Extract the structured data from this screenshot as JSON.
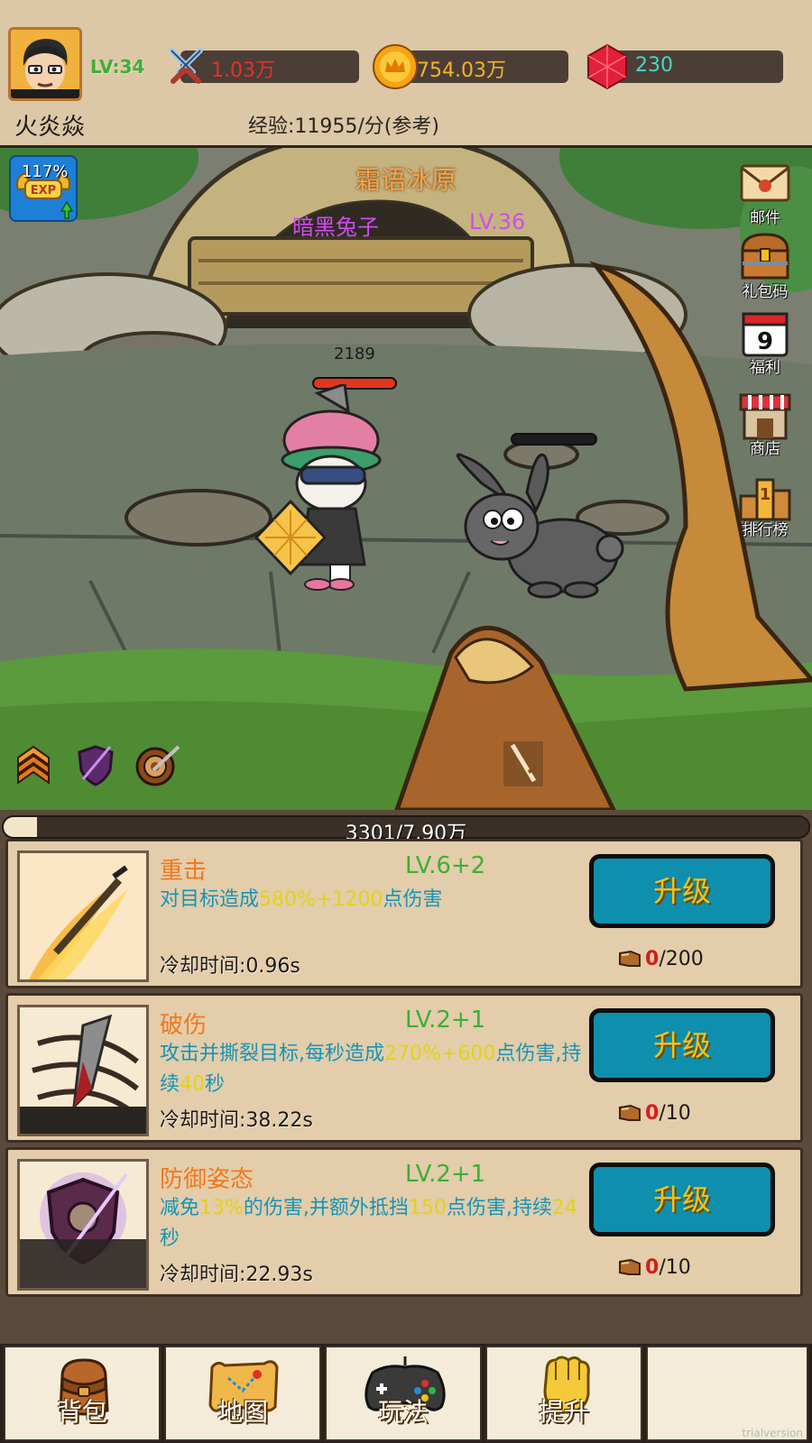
{
  "player": {
    "level": "LV:34",
    "name": "火炎焱",
    "power": "1.03万",
    "gold": "754.03万",
    "gems": "230",
    "exp_rate": "经验:11955/分(参考)"
  },
  "battle": {
    "map_name": "霜语冰原",
    "enemy_name": "暗黑兔子",
    "enemy_level": "LV.36",
    "player_hp": "2189",
    "exp_bonus": "117%",
    "exp_badge_text": "EXP"
  },
  "side_menu": [
    {
      "label": "邮件",
      "icon": "mail-icon"
    },
    {
      "label": "礼包码",
      "icon": "gift-chest-icon"
    },
    {
      "label": "福利",
      "icon": "calendar-icon",
      "badge": "9"
    },
    {
      "label": "商店",
      "icon": "shop-icon"
    },
    {
      "label": "排行榜",
      "icon": "podium-icon",
      "badge": "1"
    }
  ],
  "progress": {
    "text": "3301/7.90万",
    "fraction": 0.042
  },
  "skills": [
    {
      "name": "重击",
      "level": "LV.6+2",
      "desc_parts": [
        "对目标造成",
        "580%+1200",
        "点伤害"
      ],
      "cooldown": "冷却时间:0.96s",
      "button": "升级",
      "cost_have": "0",
      "cost_need": "/200"
    },
    {
      "name": "破伤",
      "level": "LV.2+1",
      "desc_parts": [
        "攻击并撕裂目标,每秒造成",
        "270%+600",
        "点伤害,持续",
        "40",
        "秒"
      ],
      "cooldown": "冷却时间:38.22s",
      "button": "升级",
      "cost_have": "0",
      "cost_need": "/10"
    },
    {
      "name": "防御姿态",
      "level": "LV.2+1",
      "desc_parts": [
        "减免",
        "13%",
        "的伤害,并额外抵挡",
        "150",
        "点伤害,持续",
        "24",
        "秒"
      ],
      "cooldown": "冷却时间:22.93s",
      "button": "升级",
      "cost_have": "0",
      "cost_need": "/10"
    }
  ],
  "nav": [
    {
      "label": "背包",
      "icon": "backpack-icon"
    },
    {
      "label": "地图",
      "icon": "map-icon"
    },
    {
      "label": "玩法",
      "icon": "gamepad-icon"
    },
    {
      "label": "提升",
      "icon": "fist-icon"
    },
    {
      "label": "",
      "icon": ""
    }
  ],
  "watermark": "trialversion",
  "colors": {
    "topbar": "#dcc7a6",
    "upgrade_button": "#0e8fad",
    "upgrade_text": "#f6c218",
    "skill_name": "#f07a1d",
    "skill_level": "#3caf34",
    "skill_desc": "#1594b8",
    "highlight": "#e3d313",
    "enemy_name": "#d14cf0"
  }
}
